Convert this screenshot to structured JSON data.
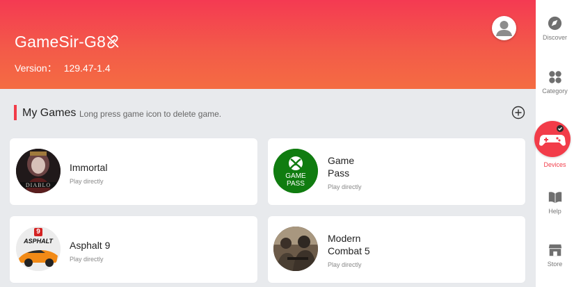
{
  "header": {
    "device_name": "GameSir-G8",
    "version_label": "Version：",
    "version_value": "129.47-1.4"
  },
  "section": {
    "title": "My Games",
    "hint": "Long press game icon to delete game."
  },
  "games": [
    {
      "name": "Immortal",
      "subtitle": "Play directly"
    },
    {
      "name_line1": "Game",
      "name_line2": "Pass",
      "subtitle": "Play directly",
      "icon_text_1": "GAME",
      "icon_text_2": "PASS"
    },
    {
      "name": "Asphalt 9",
      "subtitle": "Play directly",
      "icon_text": "ASPHALT",
      "icon_badge": "9"
    },
    {
      "name_line1": "Modern",
      "name_line2": "Combat 5",
      "subtitle": "Play directly"
    }
  ],
  "sidebar": {
    "items": [
      {
        "label": "Discover"
      },
      {
        "label": "Category"
      },
      {
        "label": "Devices"
      },
      {
        "label": "Help"
      },
      {
        "label": "Store"
      }
    ]
  },
  "colors": {
    "accent": "#f23c49",
    "header_top": "#f43a52",
    "header_bottom": "#f46c42",
    "xbox_green": "#107c10"
  },
  "icons": {
    "unlink": "unlink-icon",
    "avatar": "user-icon",
    "add": "plus-circle-icon",
    "discover": "compass-icon",
    "category": "grid-icon",
    "devices": "gamepad-icon",
    "help": "book-icon",
    "store": "store-icon"
  }
}
